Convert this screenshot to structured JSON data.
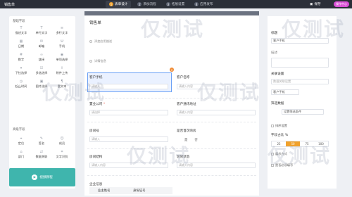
{
  "topbar": {
    "app_title": "销售单",
    "steps": [
      {
        "num": "1",
        "label": "表单设计",
        "active": true
      },
      {
        "num": "2",
        "label": "添加流程",
        "active": false
      },
      {
        "num": "3",
        "label": "拓展设置",
        "active": false
      },
      {
        "num": "4",
        "label": "应用发布",
        "active": false
      }
    ],
    "save_label": "保存",
    "publish_label": "操作中心"
  },
  "left_panel": {
    "basic_group_title": "基础字段",
    "basic_components": [
      {
        "label": "描述文字",
        "icon": "T"
      },
      {
        "label": "单行文字",
        "icon": "T"
      },
      {
        "label": "多行文字",
        "icon": "≡"
      },
      {
        "label": "日期",
        "icon": "▦"
      },
      {
        "label": "邮箱",
        "icon": "✉"
      },
      {
        "label": "手机",
        "icon": "☏"
      },
      {
        "label": "数字",
        "icon": "#"
      },
      {
        "label": "链接",
        "icon": "∞"
      },
      {
        "label": "单项选择",
        "icon": "◉"
      },
      {
        "label": "下拉选择",
        "icon": "▾"
      },
      {
        "label": "多选选择",
        "icon": "☑"
      },
      {
        "label": "附件上传",
        "icon": "⇪"
      },
      {
        "label": "起止时间",
        "icon": "◷"
      },
      {
        "label": "图片选择",
        "icon": "▣"
      },
      {
        "label": "富文本",
        "icon": "¶"
      }
    ],
    "advanced_group_title": "高级字段",
    "advanced_components": [
      {
        "label": "定位",
        "icon": "⌖"
      },
      {
        "label": "签名",
        "icon": "✎"
      },
      {
        "label": "成员",
        "icon": "☺"
      },
      {
        "label": "部门",
        "icon": "⌂"
      },
      {
        "label": "数据关联",
        "icon": "⇄"
      },
      {
        "label": "文字识别",
        "icon": "⌗"
      }
    ],
    "promo_text": "视频教程"
  },
  "canvas": {
    "form_title": "销售单",
    "options": [
      "添加应用描述",
      "详情信息"
    ],
    "fields": {
      "customer_phone": {
        "label": "客户手机",
        "placeholder": "请输入"
      },
      "customer_name": {
        "label": "客户名称",
        "placeholder": "请输入内容"
      },
      "company": {
        "label": "置业公司",
        "placeholder": "请选择"
      },
      "customer_address": {
        "label": "客户通讯地址",
        "placeholder": "请输入内容"
      },
      "house_no": {
        "label": "房间号",
        "placeholder": "请输入"
      },
      "first_purchase": {
        "label": "是否首次购房",
        "options": [
          "是",
          "否"
        ]
      },
      "room_structure": {
        "label": "房间结构",
        "placeholder": "请输入内容"
      },
      "decoration": {
        "label": "装修状态",
        "placeholder": "请输入内容"
      }
    },
    "delete_icon_symbol": "×",
    "sub_table": {
      "title": "企业信息",
      "columns": [
        "业主姓名",
        "身份证号"
      ]
    }
  },
  "right_panel": {
    "field_title_label": "标题",
    "field_title_value": "客户手机",
    "desc_label": "描述",
    "association_label": "关联设置",
    "association_value": "数据关联设置",
    "linked_field": "客户手机",
    "filter_label": "筛选数据",
    "filter_button": "设置筛选条件",
    "sort_label": "排序设置",
    "width_label": "字段占比 %",
    "width_options": [
      "25",
      "50",
      "75",
      "100"
    ],
    "width_selected": "50",
    "hidden_label": "展示方式",
    "bottom_label": "是否必须填写"
  },
  "watermark_text": "仅测试"
}
